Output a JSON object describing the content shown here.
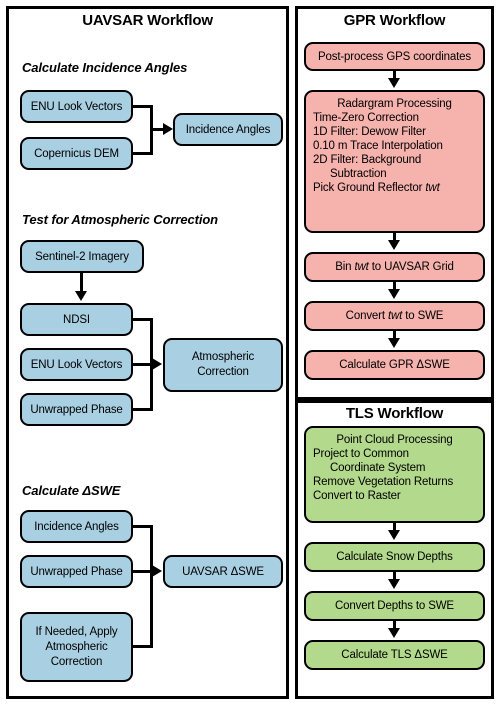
{
  "figure": {
    "panels": [
      {
        "id": "uavsar",
        "title": "UAVSAR Workflow",
        "accent": "#a9cfe2",
        "sections": [
          {
            "heading": "Calculate Incidence Angles",
            "inputs": [
              "ENU Look Vectors",
              "Copernicus DEM"
            ],
            "output": "Incidence Angles"
          },
          {
            "heading": "Test for Atmospheric Correction",
            "source": "Sentinel-2 Imagery",
            "inputs": [
              "NDSI",
              "ENU Look Vectors",
              "Unwrapped Phase"
            ],
            "output": "Atmospheric Correction"
          },
          {
            "heading": "Calculate ΔSWE",
            "inputs": [
              "Incidence Angles",
              "Unwrapped Phase",
              "If Needed, Apply Atmospheric Correction"
            ],
            "output": "UAVSAR ΔSWE"
          }
        ]
      },
      {
        "id": "gpr",
        "title": "GPR Workflow",
        "accent": "#f6b2ac",
        "steps": [
          {
            "label": "Post-process GPS coordinates"
          },
          {
            "label": "Radargram Processing",
            "sublines": [
              "Time-Zero Correction",
              "1D Filter: Dewow Filter",
              "0.10 m Trace Interpolation",
              "2D Filter: Background",
              "Subtraction",
              "Pick Ground Reflector twt"
            ]
          },
          {
            "label": "Bin twt to UAVSAR Grid"
          },
          {
            "label": "Convert twt to SWE"
          },
          {
            "label": "Calculate GPR ΔSWE"
          }
        ]
      },
      {
        "id": "tls",
        "title": "TLS Workflow",
        "accent": "#b2d98c",
        "steps": [
          {
            "label": "Point Cloud Processing",
            "sublines": [
              "Project to Common",
              "Coordinate System",
              "Remove Vegetation Returns",
              "Convert to Raster"
            ]
          },
          {
            "label": "Calculate Snow Depths"
          },
          {
            "label": "Convert Depths to SWE"
          },
          {
            "label": "Calculate TLS ΔSWE"
          }
        ]
      }
    ]
  }
}
